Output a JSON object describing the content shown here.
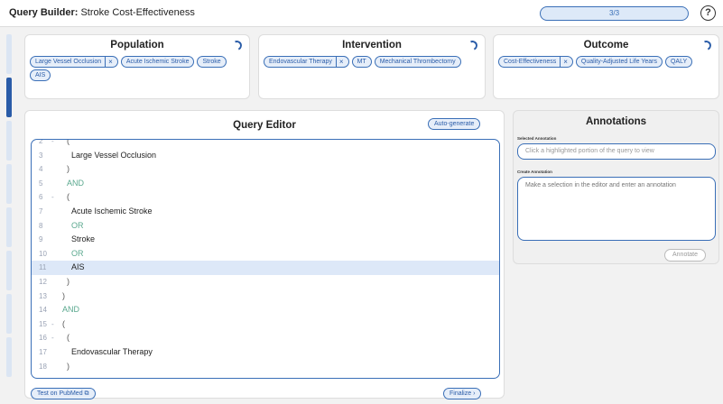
{
  "header": {
    "title_bold": "Query Builder:",
    "title_rest": "Stroke Cost-Effectiveness",
    "progress": "3/3",
    "help": "?"
  },
  "stepper": {
    "count": 8,
    "active_index": 1
  },
  "pico": [
    {
      "title": "Population",
      "terms": [
        {
          "label": "Large Vessel Occlusion",
          "removable": true
        },
        {
          "label": "Acute Ischemic Stroke",
          "removable": false
        },
        {
          "label": "Stroke",
          "removable": false
        },
        {
          "label": "AIS",
          "removable": false
        }
      ]
    },
    {
      "title": "Intervention",
      "terms": [
        {
          "label": "Endovascular Therapy",
          "removable": true
        },
        {
          "label": "MT",
          "removable": false
        },
        {
          "label": "Mechanical Thrombectomy",
          "removable": false
        }
      ]
    },
    {
      "title": "Outcome",
      "terms": [
        {
          "label": "Cost-Effectiveness",
          "removable": true
        },
        {
          "label": "Quality-Adjusted Life Years",
          "removable": false
        },
        {
          "label": "QALY",
          "removable": false
        }
      ]
    }
  ],
  "query_editor": {
    "title": "Query Editor",
    "autogen_label": "Auto-generate",
    "test_label": "Test on PubMed",
    "finalize_label": "Finalize",
    "active_line": 11,
    "lines": [
      {
        "n": "2",
        "fold": true,
        "indent": 1,
        "text": "(",
        "kind": "brace"
      },
      {
        "n": "3",
        "indent": 2,
        "text": "Large Vessel Occlusion",
        "kind": "term"
      },
      {
        "n": "4",
        "indent": 1,
        "text": ")",
        "kind": "brace"
      },
      {
        "n": "5",
        "indent": 1,
        "text": "AND",
        "kind": "op"
      },
      {
        "n": "6",
        "fold": true,
        "indent": 1,
        "text": "(",
        "kind": "brace"
      },
      {
        "n": "7",
        "indent": 2,
        "text": "Acute Ischemic Stroke",
        "kind": "term"
      },
      {
        "n": "8",
        "indent": 2,
        "text": "OR",
        "kind": "op"
      },
      {
        "n": "9",
        "indent": 2,
        "text": "Stroke",
        "kind": "term"
      },
      {
        "n": "10",
        "indent": 2,
        "text": "OR",
        "kind": "op"
      },
      {
        "n": "11",
        "indent": 2,
        "text": "AIS",
        "kind": "term"
      },
      {
        "n": "12",
        "indent": 1,
        "text": ")",
        "kind": "brace"
      },
      {
        "n": "13",
        "indent": 0,
        "text": ")",
        "kind": "brace"
      },
      {
        "n": "14",
        "indent": 0,
        "text": "AND",
        "kind": "op"
      },
      {
        "n": "15",
        "fold": true,
        "indent": 0,
        "text": "(",
        "kind": "brace"
      },
      {
        "n": "16",
        "fold": true,
        "indent": 1,
        "text": "(",
        "kind": "brace"
      },
      {
        "n": "17",
        "indent": 2,
        "text": "Endovascular Therapy",
        "kind": "term"
      },
      {
        "n": "18",
        "indent": 1,
        "text": ")",
        "kind": "brace"
      }
    ]
  },
  "annotations": {
    "title": "Annotations",
    "selected_label": "Selected Annotation",
    "selected_placeholder": "Click a highlighted portion of the query to view",
    "create_label": "Create Annotation",
    "create_placeholder": "Make a selection in the editor and enter an annotation",
    "annotate_label": "Annotate"
  }
}
